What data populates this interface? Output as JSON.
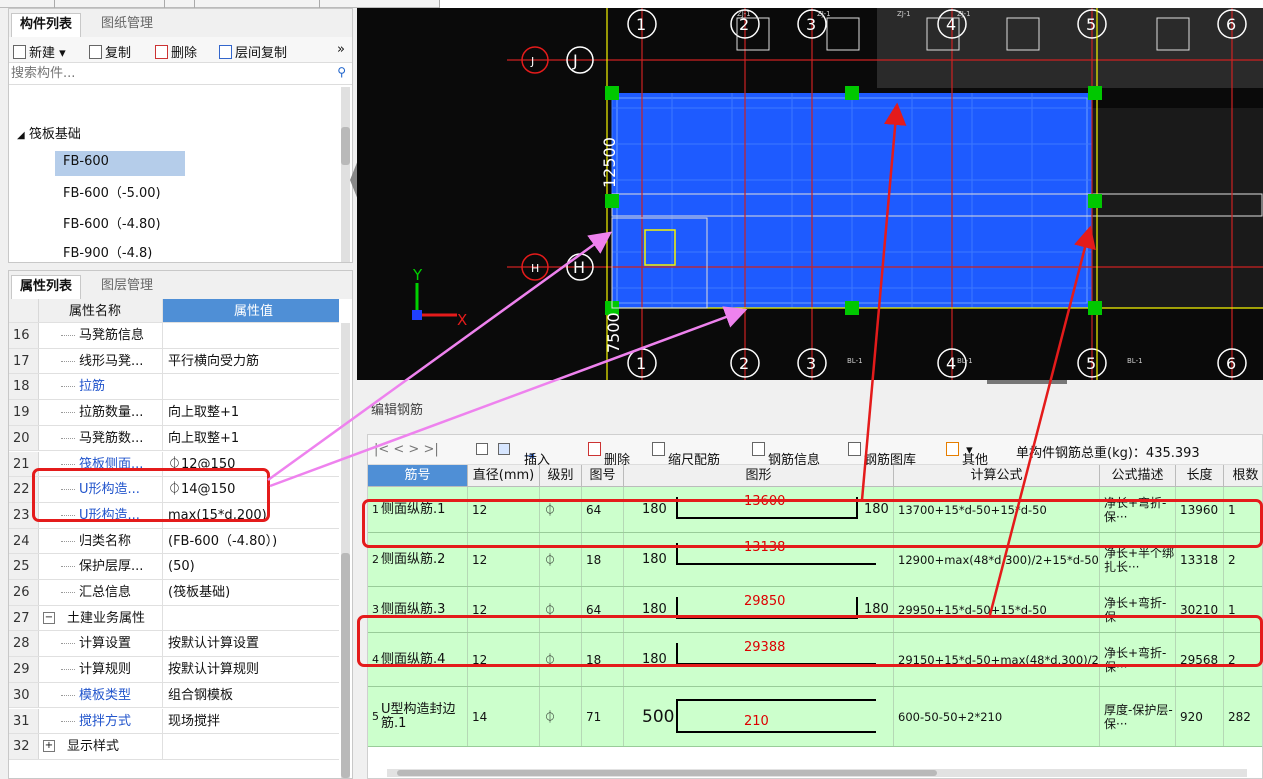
{
  "component_panel": {
    "tabs": [
      "构件列表",
      "图纸管理"
    ],
    "toolbar": {
      "new": "新建",
      "copy": "复制",
      "delete": "删除",
      "floor_copy": "层间复制",
      "more": "»"
    },
    "search_placeholder": "搜索构件...",
    "tree": {
      "group": "筏板基础",
      "items": [
        "FB-600",
        "FB-600（-5.00)",
        "FB-600（-4.80)",
        "FB-900（-4.8)"
      ],
      "selected_index": 0
    }
  },
  "property_panel": {
    "tabs": [
      "属性列表",
      "图层管理"
    ],
    "headers": {
      "name": "属性名称",
      "value": "属性值"
    },
    "rows": [
      {
        "num": "16",
        "name": "马凳筋信息",
        "value": "",
        "blue": false
      },
      {
        "num": "17",
        "name": "线形马凳...",
        "value": "平行横向受力筋",
        "blue": false
      },
      {
        "num": "18",
        "name": "拉筋",
        "value": "",
        "blue": true
      },
      {
        "num": "19",
        "name": "拉筋数量...",
        "value": "向上取整+1",
        "blue": false
      },
      {
        "num": "20",
        "name": "马凳筋数...",
        "value": "向上取整+1",
        "blue": false
      },
      {
        "num": "21",
        "name": "筏板侧面...",
        "value": "⏀12@150",
        "blue": true
      },
      {
        "num": "22",
        "name": "U形构造...",
        "value": "⏀14@150",
        "blue": true
      },
      {
        "num": "23",
        "name": "U形构造...",
        "value": "max(15*d,200)",
        "blue": true
      },
      {
        "num": "24",
        "name": "归类名称",
        "value": "(FB-600（-4.80）)",
        "blue": false
      },
      {
        "num": "25",
        "name": "保护层厚...",
        "value": "(50)",
        "blue": false
      },
      {
        "num": "26",
        "name": "汇总信息",
        "value": "(筏板基础)",
        "blue": false
      },
      {
        "num": "27",
        "name": "土建业务属性",
        "value": "",
        "blue": false,
        "group": true,
        "toggle": "−"
      },
      {
        "num": "28",
        "name": "计算设置",
        "value": "按默认计算设置",
        "blue": false
      },
      {
        "num": "29",
        "name": "计算规则",
        "value": "按默认计算规则",
        "blue": false
      },
      {
        "num": "30",
        "name": "模板类型",
        "value": "组合钢模板",
        "blue": true
      },
      {
        "num": "31",
        "name": "搅拌方式",
        "value": "现场搅拌",
        "blue": true
      },
      {
        "num": "32",
        "name": "显示样式",
        "value": "",
        "blue": false,
        "group": true,
        "toggle": "+"
      }
    ]
  },
  "cad": {
    "axis_top": [
      "1",
      "2",
      "3",
      "4",
      "5",
      "6"
    ],
    "axis_bottom": [
      "1",
      "2",
      "3",
      "4",
      "5",
      "6"
    ],
    "axis_left": [
      "J",
      "J",
      "H",
      "H"
    ],
    "dim_12500": "12500",
    "dim_7500": "7500",
    "axis_x": "X",
    "axis_y": "Y",
    "small_text": [
      "ZJ-1",
      "ZJ-1",
      "ZJ-1",
      "ZJ-1",
      "BL-1",
      "BL-1",
      "BL-1"
    ],
    "colors": {
      "slab": "#1e5bff",
      "grid_line": "#cc2222",
      "green_handle": "#00c800",
      "yellow": "#f5f500"
    }
  },
  "rebar_editor": {
    "title": "编辑钢筋",
    "toolbar": {
      "nav": "|< < > >|",
      "insert": "插入",
      "delete": "删除",
      "scale": "缩尺配筋",
      "info": "钢筋信息",
      "library": "钢筋图库",
      "other": "其他",
      "total": "单构件钢筋总重(kg)：435.393"
    },
    "columns": [
      "筋号",
      "直径(mm)",
      "级别",
      "图号",
      "图形",
      "计算公式",
      "公式描述",
      "长度",
      "根数"
    ],
    "rows": [
      {
        "idx": "1",
        "name": "侧面纵筋.1",
        "dia": "12",
        "grade": "⏀",
        "fig": "64",
        "left": "180",
        "mid": "13600",
        "right": "180",
        "formula": "13700+15*d-50+15*d-50",
        "desc": "净长+弯折-保···",
        "len": "13960",
        "count": "1"
      },
      {
        "idx": "2",
        "name": "侧面纵筋.2",
        "dia": "12",
        "grade": "⏀",
        "fig": "18",
        "left": "180",
        "mid": "13138",
        "right": "",
        "formula": "12900+max(48*d,300)/2+15*d-50",
        "desc": "净长+半个绑扎长···",
        "len": "13318",
        "count": "2"
      },
      {
        "idx": "3",
        "name": "侧面纵筋.3",
        "dia": "12",
        "grade": "⏀",
        "fig": "64",
        "left": "180",
        "mid": "29850",
        "right": "180",
        "formula": "29950+15*d-50+15*d-50",
        "desc": "净长+弯折-保···",
        "len": "30210",
        "count": "1"
      },
      {
        "idx": "4",
        "name": "侧面纵筋.4",
        "dia": "12",
        "grade": "⏀",
        "fig": "18",
        "left": "180",
        "mid": "29388",
        "right": "",
        "formula": "29150+15*d-50+max(48*d,300)/2",
        "desc": "净长+弯折-保···",
        "len": "29568",
        "count": "2"
      },
      {
        "idx": "5",
        "name": "U型构造封边筋.1",
        "dia": "14",
        "grade": "⏀",
        "fig": "71",
        "left": "500",
        "mid": "210",
        "right": "",
        "formula": "600-50-50+2*210",
        "desc": "厚度-保护层-保···",
        "len": "920",
        "count": "282"
      }
    ]
  },
  "annotation_colors": {
    "red_box": "#e41b1b",
    "pink_arrow": "#ee82ee",
    "red_arrow": "#e41b1b"
  }
}
